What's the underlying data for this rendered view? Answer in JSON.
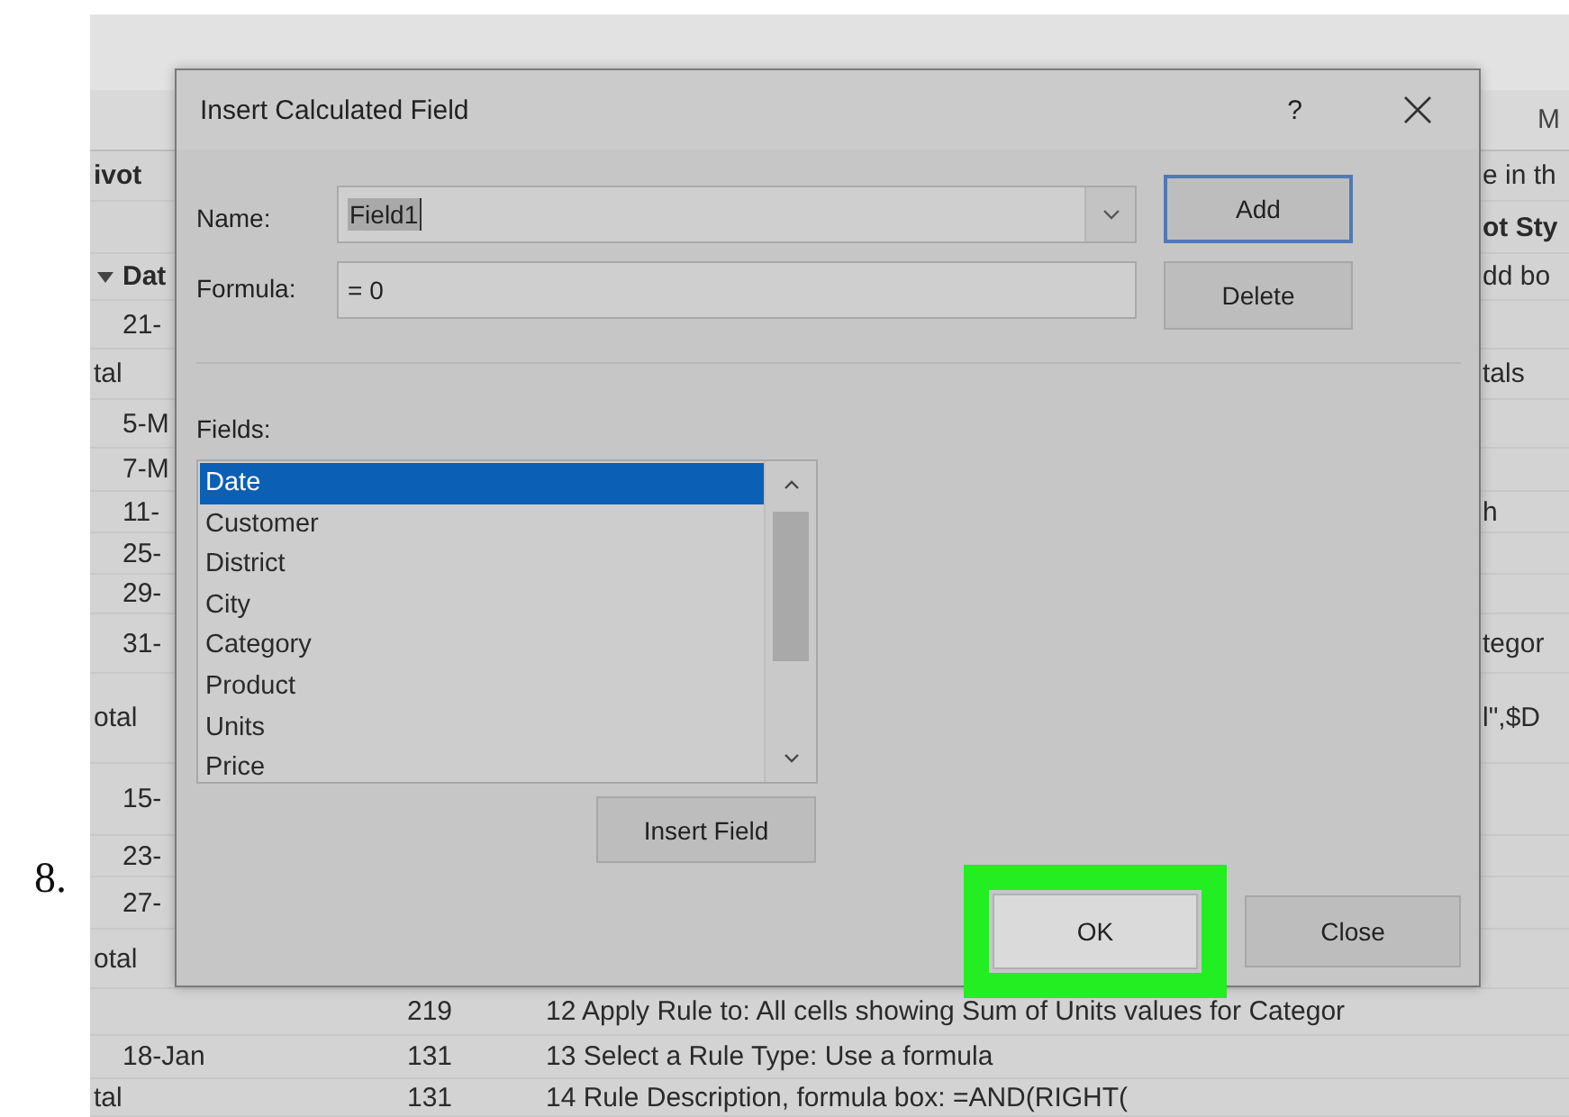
{
  "step_number": "8.",
  "sheet": {
    "column_header": "M",
    "rows": [
      {
        "kind": "data",
        "cells": [
          {
            "text": "ivot",
            "bold": true
          },
          null,
          null,
          null,
          {
            "text": "e in th",
            "bold": false
          }
        ]
      },
      {
        "kind": "data",
        "cells": [
          null,
          null,
          null,
          null,
          {
            "text": "ot Sty",
            "bold": true
          }
        ]
      },
      {
        "kind": "header",
        "cells": [
          null,
          {
            "text": "Dat",
            "bold": true
          },
          null,
          null,
          {
            "text": "dd bo",
            "bold": false
          }
        ]
      },
      {
        "kind": "data",
        "cells": [
          null,
          {
            "text": "21-",
            "bold": false
          }
        ]
      },
      {
        "kind": "data",
        "cells": [
          {
            "text": "tal",
            "bold": false
          },
          null,
          null,
          null,
          {
            "text": "tals",
            "bold": false
          }
        ]
      },
      {
        "kind": "data",
        "cells": [
          null,
          {
            "text": "5-M",
            "bold": false
          }
        ]
      },
      {
        "kind": "data",
        "cells": [
          null,
          {
            "text": "7-M",
            "bold": false
          }
        ]
      },
      {
        "kind": "data",
        "cells": [
          null,
          {
            "text": "11-",
            "bold": false
          },
          null,
          null,
          {
            "text": "h",
            "bold": false
          }
        ]
      },
      {
        "kind": "data",
        "cells": [
          null,
          {
            "text": "25-",
            "bold": false
          }
        ]
      },
      {
        "kind": "data",
        "cells": [
          null,
          {
            "text": "29-",
            "bold": false
          }
        ]
      },
      {
        "kind": "data",
        "cells": [
          null,
          {
            "text": "31-",
            "bold": false
          },
          null,
          null,
          {
            "text": "tegor",
            "bold": false
          }
        ]
      },
      {
        "kind": "data",
        "cells": [
          {
            "text": "otal",
            "bold": false
          },
          null,
          null,
          null,
          {
            "text": "l\",$D",
            "bold": false
          }
        ]
      },
      {
        "kind": "data",
        "cells": [
          null,
          {
            "text": "15-",
            "bold": false
          }
        ]
      },
      {
        "kind": "data",
        "cells": [
          null,
          {
            "text": "23-",
            "bold": false
          }
        ]
      },
      {
        "kind": "data",
        "cells": [
          null,
          {
            "text": "27-",
            "bold": false
          }
        ]
      },
      {
        "kind": "data",
        "cells": [
          {
            "text": "otal",
            "bold": false
          }
        ]
      },
      {
        "kind": "data",
        "cells": [
          null,
          null,
          {
            "text": "219",
            "bold": false
          },
          {
            "text": "12 Apply Rule to: All cells showing Sum of Units values for Categor",
            "bold": false
          }
        ]
      },
      {
        "kind": "data",
        "cells": [
          null,
          {
            "text": "18-Jan",
            "bold": false
          },
          {
            "text": "131",
            "bold": false
          },
          {
            "text": "13 Select a Rule Type: Use a formula",
            "bold": false
          }
        ]
      },
      {
        "kind": "data",
        "cells": [
          {
            "text": "tal",
            "bold": false
          },
          null,
          {
            "text": "131",
            "bold": false
          },
          {
            "text": "14 Rule Description, formula box: =AND(RIGHT(",
            "bold": false
          }
        ]
      }
    ]
  },
  "dialog": {
    "title": "Insert Calculated Field",
    "help": "?",
    "name_label": "Name:",
    "name_value": "Field1",
    "name_selected": true,
    "formula_label": "Formula:",
    "formula_value": "= 0",
    "side_buttons": [
      {
        "label": "Add",
        "default": true
      },
      {
        "label": "Delete",
        "default": false
      }
    ],
    "fields_label": "Fields:",
    "fields": [
      {
        "label": "Date",
        "selected": true
      },
      {
        "label": "Customer",
        "selected": false
      },
      {
        "label": "District",
        "selected": false
      },
      {
        "label": "City",
        "selected": false
      },
      {
        "label": "Category",
        "selected": false
      },
      {
        "label": "Product",
        "selected": false
      },
      {
        "label": "Units",
        "selected": false
      },
      {
        "label": "Price",
        "selected": false
      }
    ],
    "insert_button": "Insert Field",
    "footer_buttons": [
      {
        "label": "OK",
        "highlighted": true
      },
      {
        "label": "Close",
        "highlighted": false
      }
    ]
  }
}
